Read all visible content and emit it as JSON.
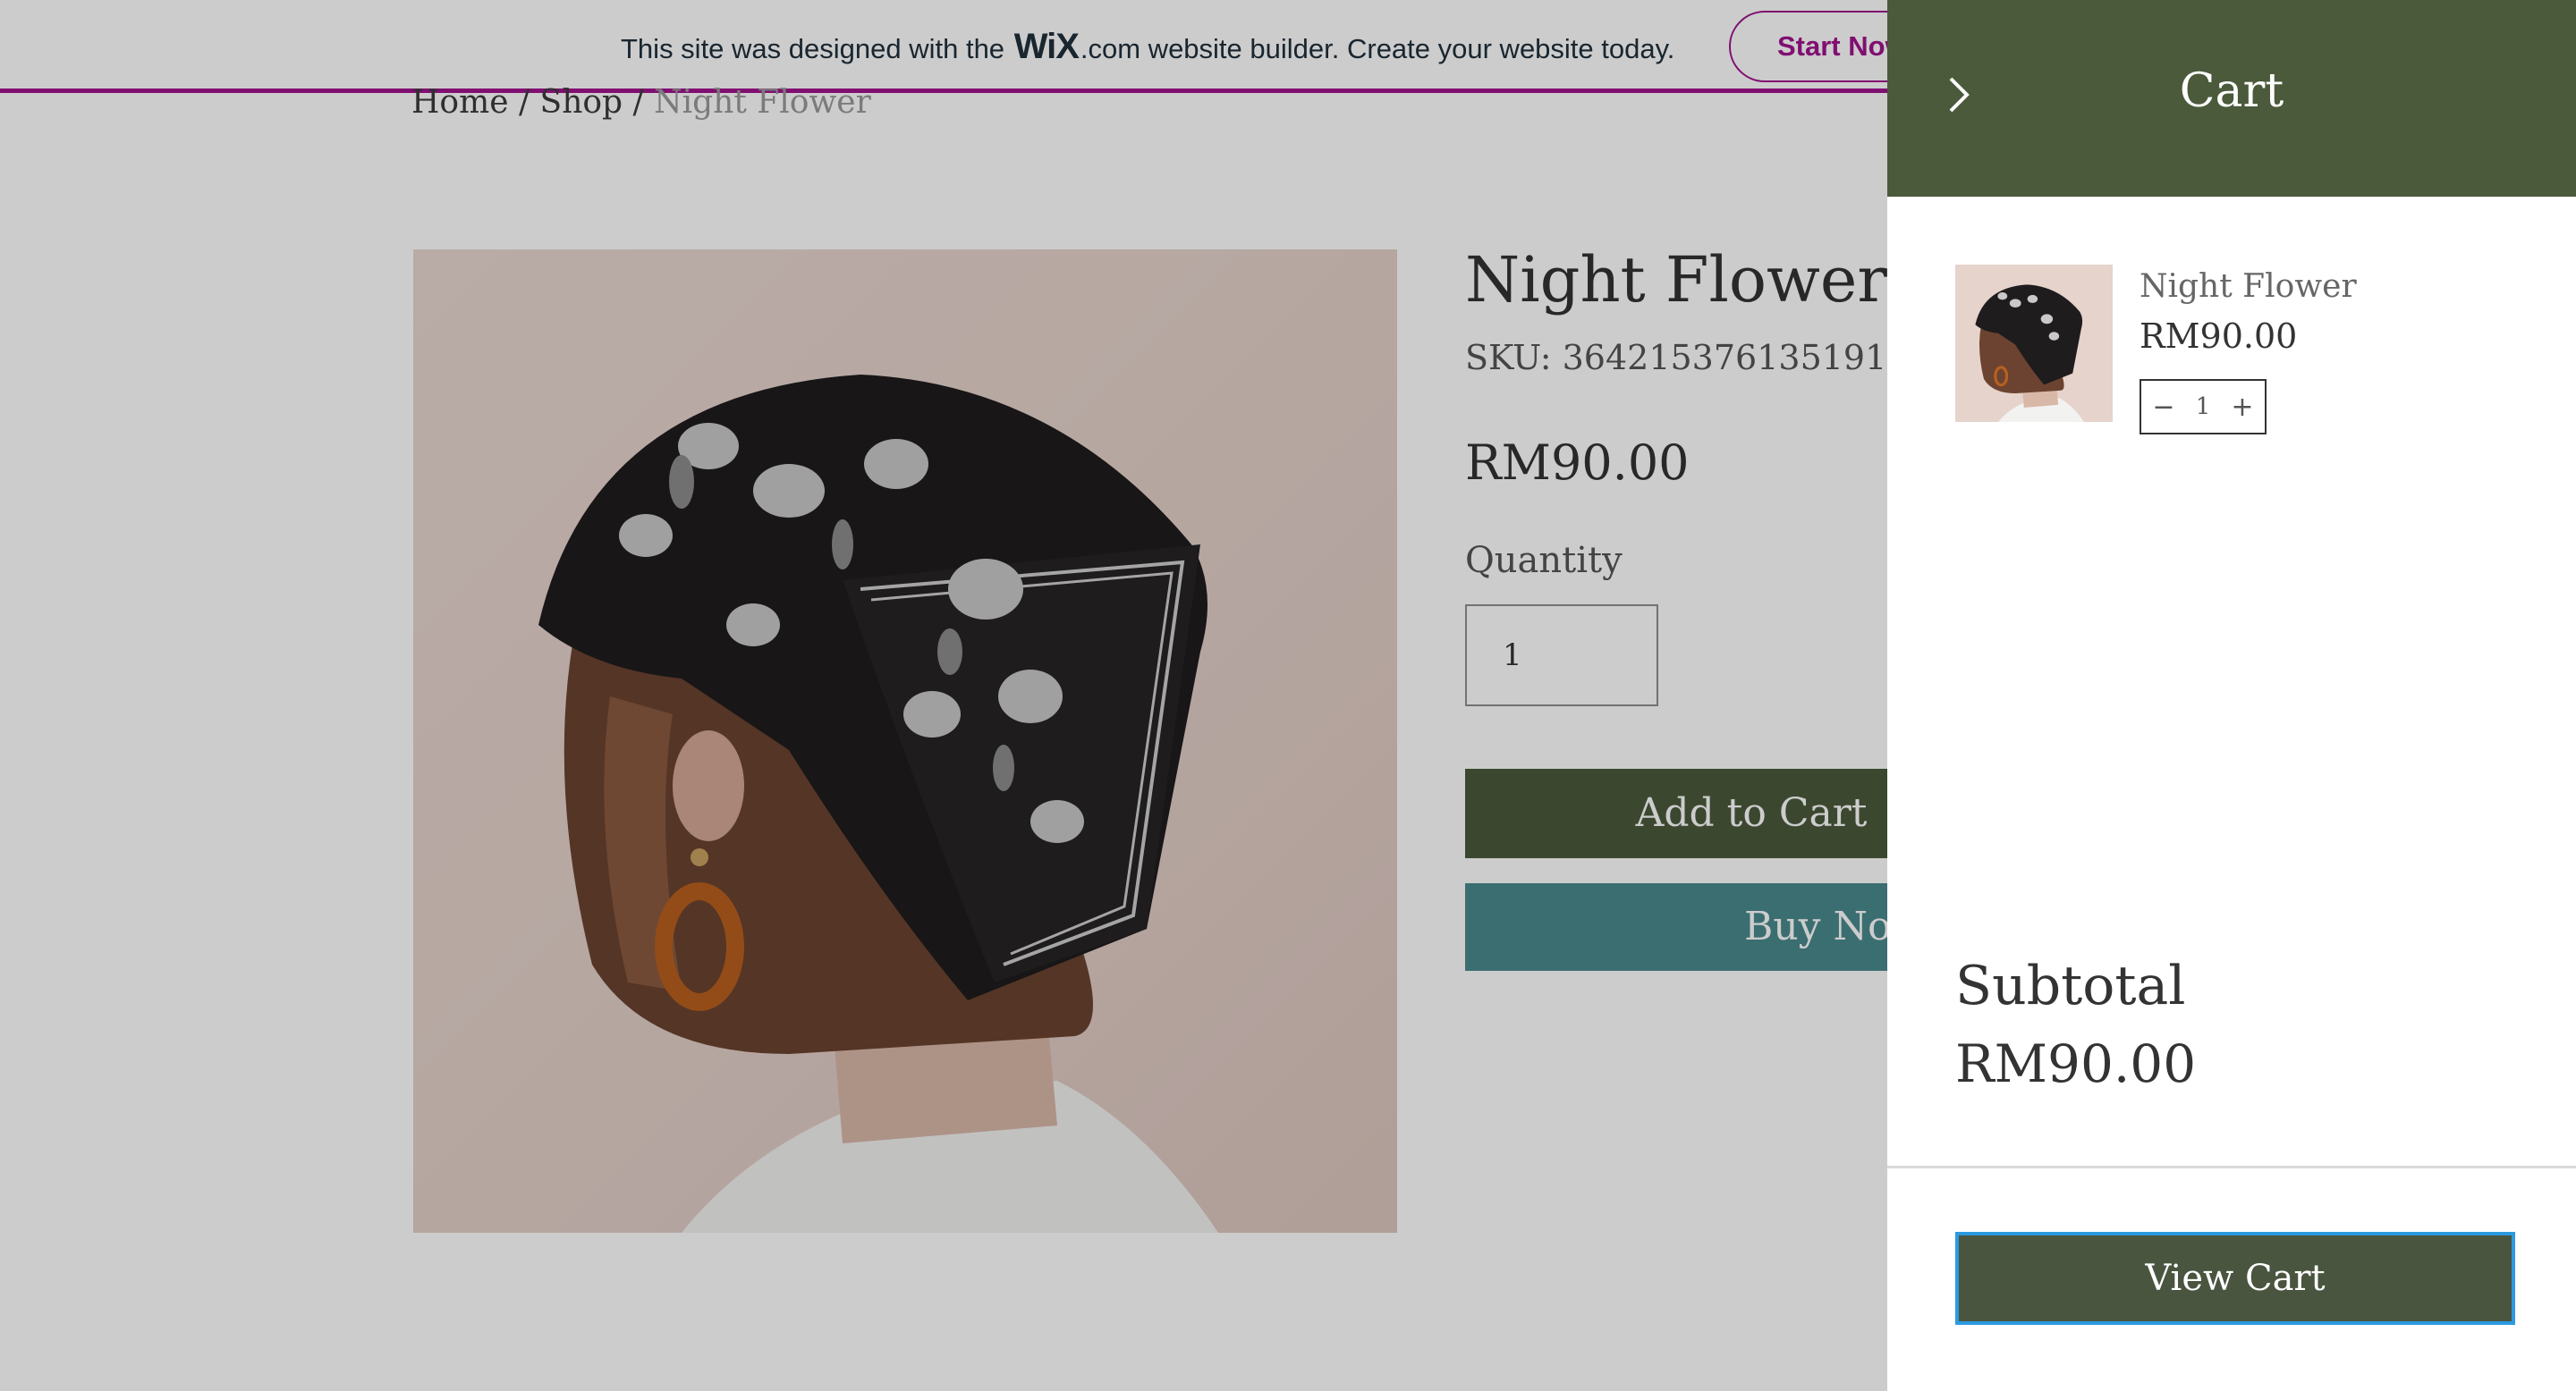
{
  "banner": {
    "text_before": "This site was designed with the",
    "logo": "WiX",
    "text_after": ".com website builder. Create your website today.",
    "button": "Start Now",
    "accent_color": "#a0138e"
  },
  "breadcrumb": {
    "home": "Home",
    "sep1": " / ",
    "shop": "Shop",
    "sep2": " / ",
    "current": "Night Flower"
  },
  "product": {
    "title": "Night Flower",
    "sku": "SKU: 364215376135191",
    "price": "RM90.00",
    "quantity_label": "Quantity",
    "quantity": "1",
    "add_to_cart": "Add to Cart",
    "buy_now": "Buy Now"
  },
  "cart": {
    "title": "Cart",
    "close_icon": "chevron-right-icon",
    "items": [
      {
        "name": "Night Flower",
        "price": "RM90.00",
        "quantity": "1"
      }
    ],
    "subtotal_label": "Subtotal",
    "subtotal_value": "RM90.00",
    "view_cart": "View Cart"
  },
  "colors": {
    "header_green": "#4a5a3b",
    "buy_now_teal": "#4a8a8e",
    "focus_blue": "#2b9ae0"
  }
}
